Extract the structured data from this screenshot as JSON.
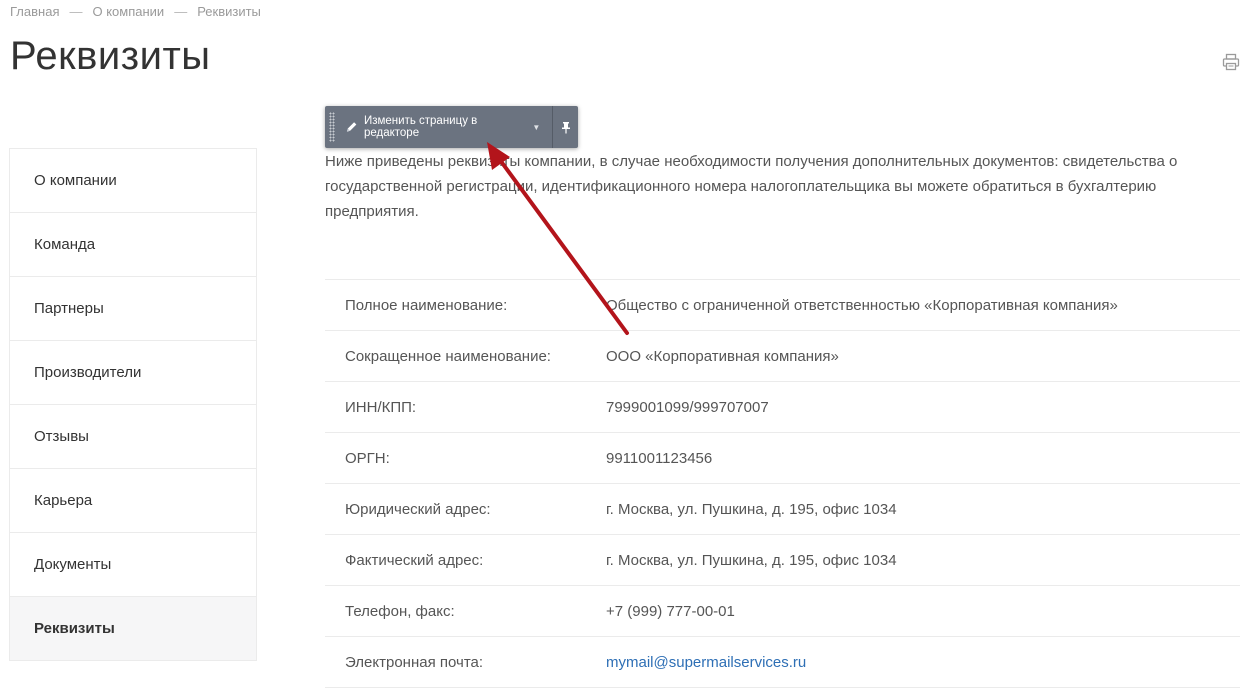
{
  "breadcrumb": {
    "items": [
      "Главная",
      "О компании",
      "Реквизиты"
    ],
    "separator": "—"
  },
  "page": {
    "title": "Реквизиты"
  },
  "icons": {
    "print": "print-icon",
    "edit": "pencil-icon",
    "pin": "pin-icon"
  },
  "sidebar": {
    "items": [
      {
        "label": "О компании"
      },
      {
        "label": "Команда"
      },
      {
        "label": "Партнеры"
      },
      {
        "label": "Производители"
      },
      {
        "label": "Отзывы"
      },
      {
        "label": "Карьера"
      },
      {
        "label": "Документы"
      },
      {
        "label": "Реквизиты",
        "active": true
      }
    ]
  },
  "editor": {
    "button_label": "Изменить страницу в редакторе"
  },
  "intro": {
    "text": "Ниже приведены реквизиты компании, в случае необходимости получения дополнительных документов: свидетельства о государственной регистрации, идентификационного номера налогоплательщика вы можете обратиться в бухгалтерию предприятия."
  },
  "details": {
    "rows": [
      {
        "label": "Полное наименование:",
        "value": "Общество с ограниченной ответственностью «Корпоративная компания»"
      },
      {
        "label": "Сокращенное наименование:",
        "value": "ООО «Корпоративная компания»"
      },
      {
        "label": "ИНН/КПП:",
        "value": "7999001099/999707007"
      },
      {
        "label": "ОРГН:",
        "value": "9911001123456"
      },
      {
        "label": "Юридический адрес:",
        "value": "г. Москва, ул. Пушкина, д. 195, офис 1034"
      },
      {
        "label": "Фактический адрес:",
        "value": "г. Москва, ул. Пушкина, д. 195, офис 1034"
      },
      {
        "label": "Телефон, факс:",
        "value": "+7 (999) 777-00-01"
      },
      {
        "label": "Электронная почта:",
        "value": "mymail@supermailservices.ru"
      }
    ]
  },
  "colors": {
    "accent_link": "#2e6fb5",
    "annotation_arrow": "#b3141b",
    "editor_bar": "#6b7380"
  }
}
